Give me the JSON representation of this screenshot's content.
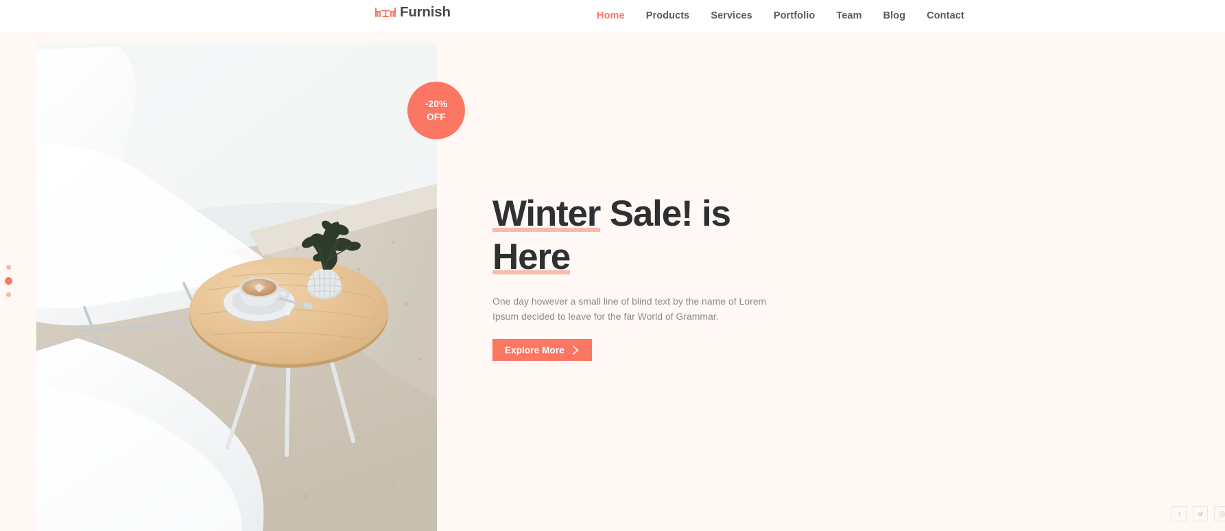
{
  "header": {
    "brand": {
      "name": "Furnish",
      "icon": "table-chairs-icon"
    },
    "nav": [
      {
        "label": "Home",
        "active": true
      },
      {
        "label": "Products",
        "active": false
      },
      {
        "label": "Services",
        "active": false
      },
      {
        "label": "Portfolio",
        "active": false
      },
      {
        "label": "Team",
        "active": false
      },
      {
        "label": "Blog",
        "active": false
      },
      {
        "label": "Contact",
        "active": false
      }
    ]
  },
  "hero": {
    "badge": {
      "line1": "-20%",
      "line2": "OFF"
    },
    "title": {
      "part1": "Winter",
      "part2": " Sale! is ",
      "part3": "Here"
    },
    "subtitle": "One day however a small line of blind text by the name of Lorem Ipsum decided to leave for the far World of Grammar.",
    "cta": {
      "label": "Explore More",
      "icon": "chevron-right-icon"
    },
    "slider": {
      "count": 3,
      "active_index": 1
    }
  },
  "social": [
    {
      "name": "facebook-icon",
      "label": "Facebook"
    },
    {
      "name": "twitter-icon",
      "label": "Twitter"
    },
    {
      "name": "instagram-icon",
      "label": "Instagram"
    }
  ],
  "colors": {
    "accent": "#fb7763",
    "accent_light": "#f9b9ab",
    "hero_bg": "#fff8f4",
    "heading": "#2f3031",
    "body_text": "#8a8a92",
    "nav_text": "#5a5a62"
  }
}
